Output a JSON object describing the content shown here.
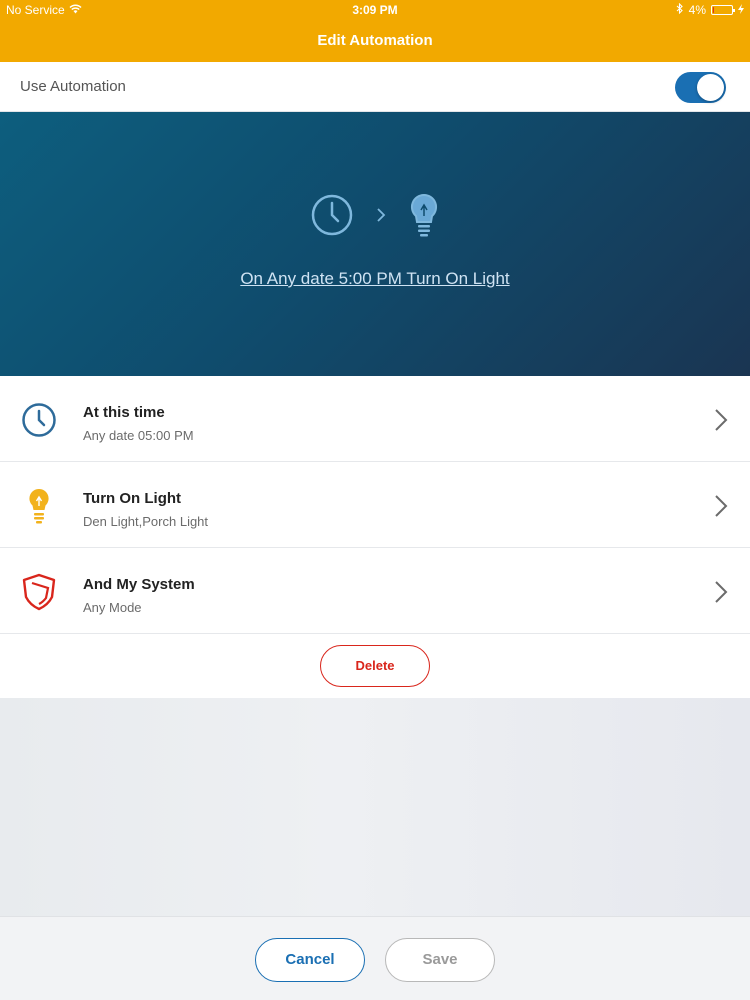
{
  "status_bar": {
    "carrier": "No Service",
    "time": "3:09 PM",
    "battery_percent": "4%",
    "battery_level": 0.04
  },
  "nav": {
    "title": "Edit Automation"
  },
  "use_automation": {
    "label": "Use Automation",
    "enabled": true
  },
  "hero": {
    "summary": "On Any date 5:00 PM Turn On Light"
  },
  "rows": [
    {
      "title": "At this time",
      "subtitle": "Any date 05:00 PM",
      "icon": "clock-icon"
    },
    {
      "title": "Turn On Light",
      "subtitle": "Den Light,Porch Light",
      "icon": "lightbulb-icon"
    },
    {
      "title": "And My System",
      "subtitle": "Any Mode",
      "icon": "shield-icon"
    }
  ],
  "delete_label": "Delete",
  "footer": {
    "cancel_label": "Cancel",
    "save_label": "Save"
  },
  "colors": {
    "nav_bar": "#f2a900",
    "accent_blue": "#1a6fb3",
    "delete_red": "#d9261c",
    "hero_gradient_start": "#0d5e7e",
    "hero_gradient_end": "#1a3552"
  }
}
